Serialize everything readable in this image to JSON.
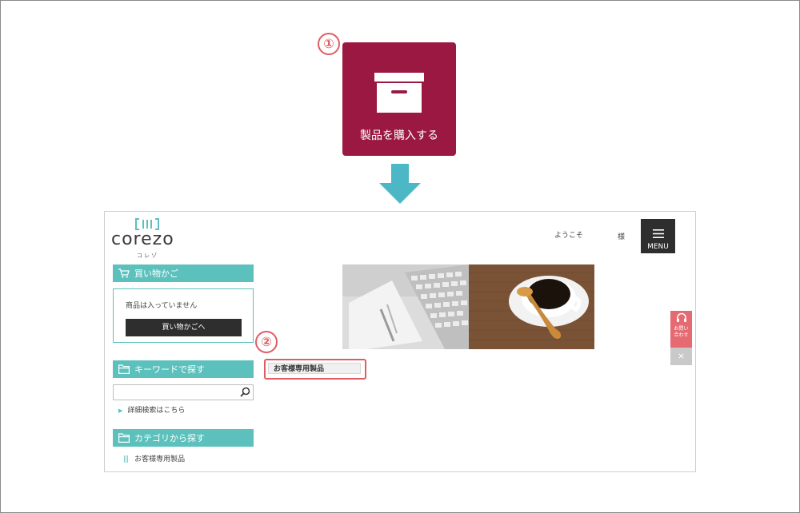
{
  "steps": {
    "one": "①",
    "two": "②"
  },
  "purchase_button": {
    "label": "製品を購入する"
  },
  "site": {
    "logo": {
      "word": "corezo",
      "kana": "コレゾ"
    },
    "welcome": "ようこそ",
    "honorific": "様",
    "menu_label": "MENU",
    "cart": {
      "heading": "買い物かご",
      "empty_message": "商品は入っていません",
      "button": "買い物かごへ"
    },
    "keyword": {
      "heading": "キーワードで探す",
      "advanced_link": "詳細検索はこちら"
    },
    "category": {
      "heading": "カテゴリから探す",
      "item": "お客様専用製品"
    },
    "product_button": "お客様専用製品"
  },
  "contact_tab": {
    "line1": "お問い",
    "line2": "合わせ"
  },
  "close_tab": "×",
  "colors": {
    "accent": "#9a1842",
    "teal": "#5cc1bd",
    "marker": "#e05c63",
    "dark": "#2e2e2e"
  }
}
